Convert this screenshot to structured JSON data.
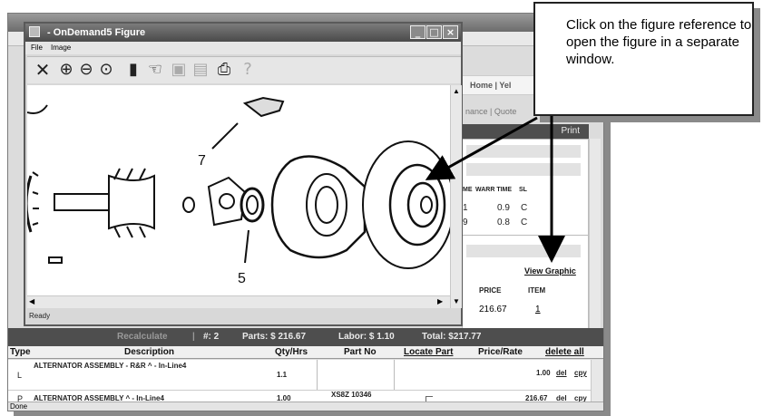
{
  "figure_window": {
    "title": "- OnDemand5 Figure",
    "menu": [
      "File",
      "Image"
    ],
    "status": "Ready",
    "callout_numbers": [
      "7",
      "5"
    ]
  },
  "background_window": {
    "nav": "Home | Yel",
    "nav2": "nance | Quote",
    "print": "Print",
    "labor_headers": [
      "ME",
      "WARR TIME",
      "SL"
    ],
    "labor_rows": [
      [
        "1",
        "0.9",
        "C"
      ],
      [
        "9",
        "0.8",
        "C"
      ]
    ],
    "view_graphic": "View Graphic",
    "price_headers": [
      "PRICE",
      "ITEM"
    ],
    "price_row": [
      "216.67",
      "1"
    ]
  },
  "summary": {
    "recalculate": "Recalculate",
    "separator": "|",
    "count": "#: 2",
    "parts": "Parts: $ 216.67",
    "labor": "Labor: $ 1.10",
    "total": "Total: $217.77"
  },
  "table": {
    "headers": [
      "Type",
      "Description",
      "Qty/Hrs",
      "Part No",
      "Locate Part",
      "Price/Rate",
      "delete all"
    ],
    "rows": [
      {
        "type": "L",
        "desc": "ALTERNATOR ASSEMBLY - R&R ^ - In-Line4",
        "qty": "1.1",
        "part": "",
        "price": "1.00",
        "del": "del",
        "cpy": "cpy"
      },
      {
        "type": "P",
        "desc": "ALTERNATOR ASSEMBLY ^ - In-Line4",
        "qty": "1.00",
        "part": "XS8Z 10346",
        "price": "216.67",
        "del": "del",
        "cpy": "cpy"
      }
    ]
  },
  "status_bar": "Done",
  "callout": "Click on the figure reference to open the figure in a separate window."
}
